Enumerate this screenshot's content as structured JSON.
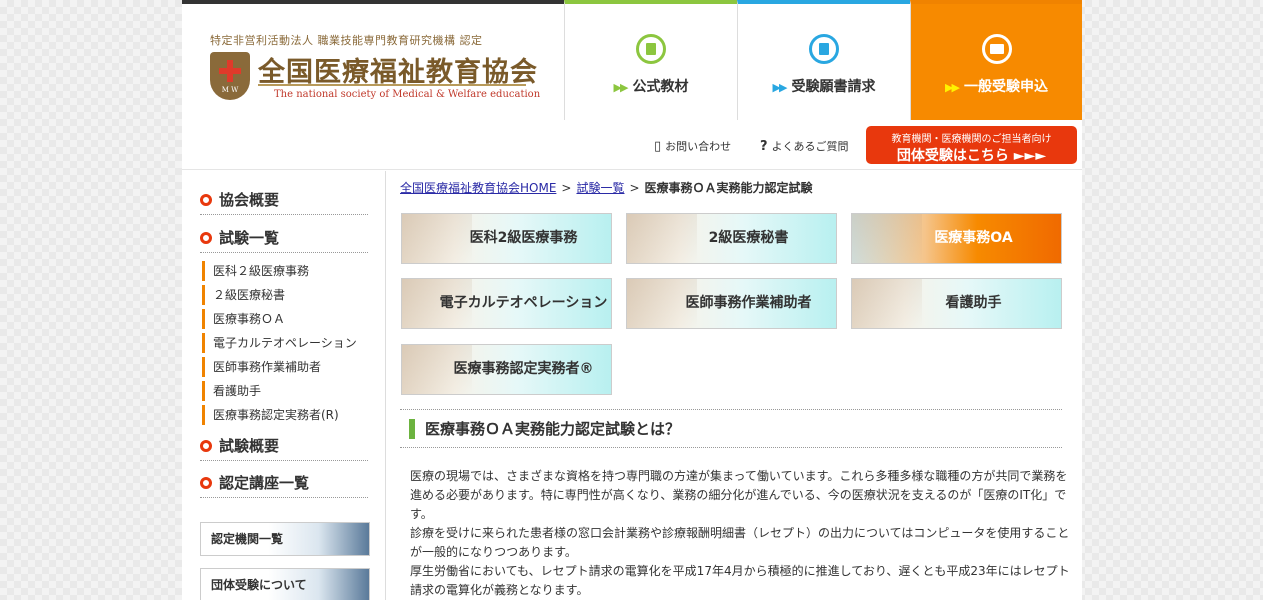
{
  "header": {
    "logo_sub": "特定非営利活動法人 職業技能専門教育研究機構 認定",
    "logo_title": "全国医療福祉教育協会",
    "logo_en": "The national society of Medical & Welfare education",
    "logo_mark_letters": "M W",
    "nav": [
      {
        "label": "公式教材",
        "color": "#8cc63f"
      },
      {
        "label": "受験願書請求",
        "color": "#29a7e1"
      },
      {
        "label": "一般受験申込",
        "color": "#f78a00"
      }
    ],
    "arrow": "▶▶"
  },
  "util": {
    "contact": "お問い合わせ",
    "faq": "よくあるご質問",
    "group_small": "教育機関・医療機関のご担当者向け",
    "group_big": "団体受験はこちら ►►►"
  },
  "sidebar": {
    "about": "協会概要",
    "exams": "試験一覧",
    "exam_items": [
      "医科２級医療事務",
      "２級医療秘書",
      "医療事務ＯＡ",
      "電子カルテオペレーション",
      "医師事務作業補助者",
      "看護助手",
      "医療事務認定実務者(R)"
    ],
    "outline": "試験概要",
    "courses": "認定講座一覧",
    "banners": [
      "認定機関一覧",
      "団体受験について"
    ]
  },
  "breadcrumb": {
    "home": "全国医療福祉教育協会HOME",
    "list": "試験一覧",
    "current": "医療事務ＯＡ実務能力認定試験",
    "sep": ">"
  },
  "exam_buttons": [
    "医科2級医療事務",
    "2級医療秘書",
    "医療事務OA",
    "電子カルテオペレーション",
    "医師事務作業補助者",
    "看護助手",
    "医療事務認定実務者®"
  ],
  "section": {
    "title": "医療事務ＯＡ実務能力認定試験とは？",
    "p1": "医療の現場では、さまざまな資格を持つ専門職の方達が集まって働いています。これら多種多様な職種の方が共同で業務を進める必要があります。特に専門性が高くなり、業務の細分化が進んでいる、今の医療状況を支えるのが「医療のIT化」です。",
    "p2": "診療を受けに来られた患者様の窓口会計業務や診療報酬明細書（レセプト）の出力についてはコンピュータを使用することが一般的になりつつあります。",
    "p3": "厚生労働省においても、レセプト請求の電算化を平成17年4月から積極的に推進しており、遅くとも平成23年にはレセプト請求の電算化が義務となります。"
  },
  "colors": {
    "accent_orange": "#f78a00",
    "accent_red": "#e8380d",
    "accent_green": "#8cc63f",
    "accent_blue": "#29a7e1"
  }
}
